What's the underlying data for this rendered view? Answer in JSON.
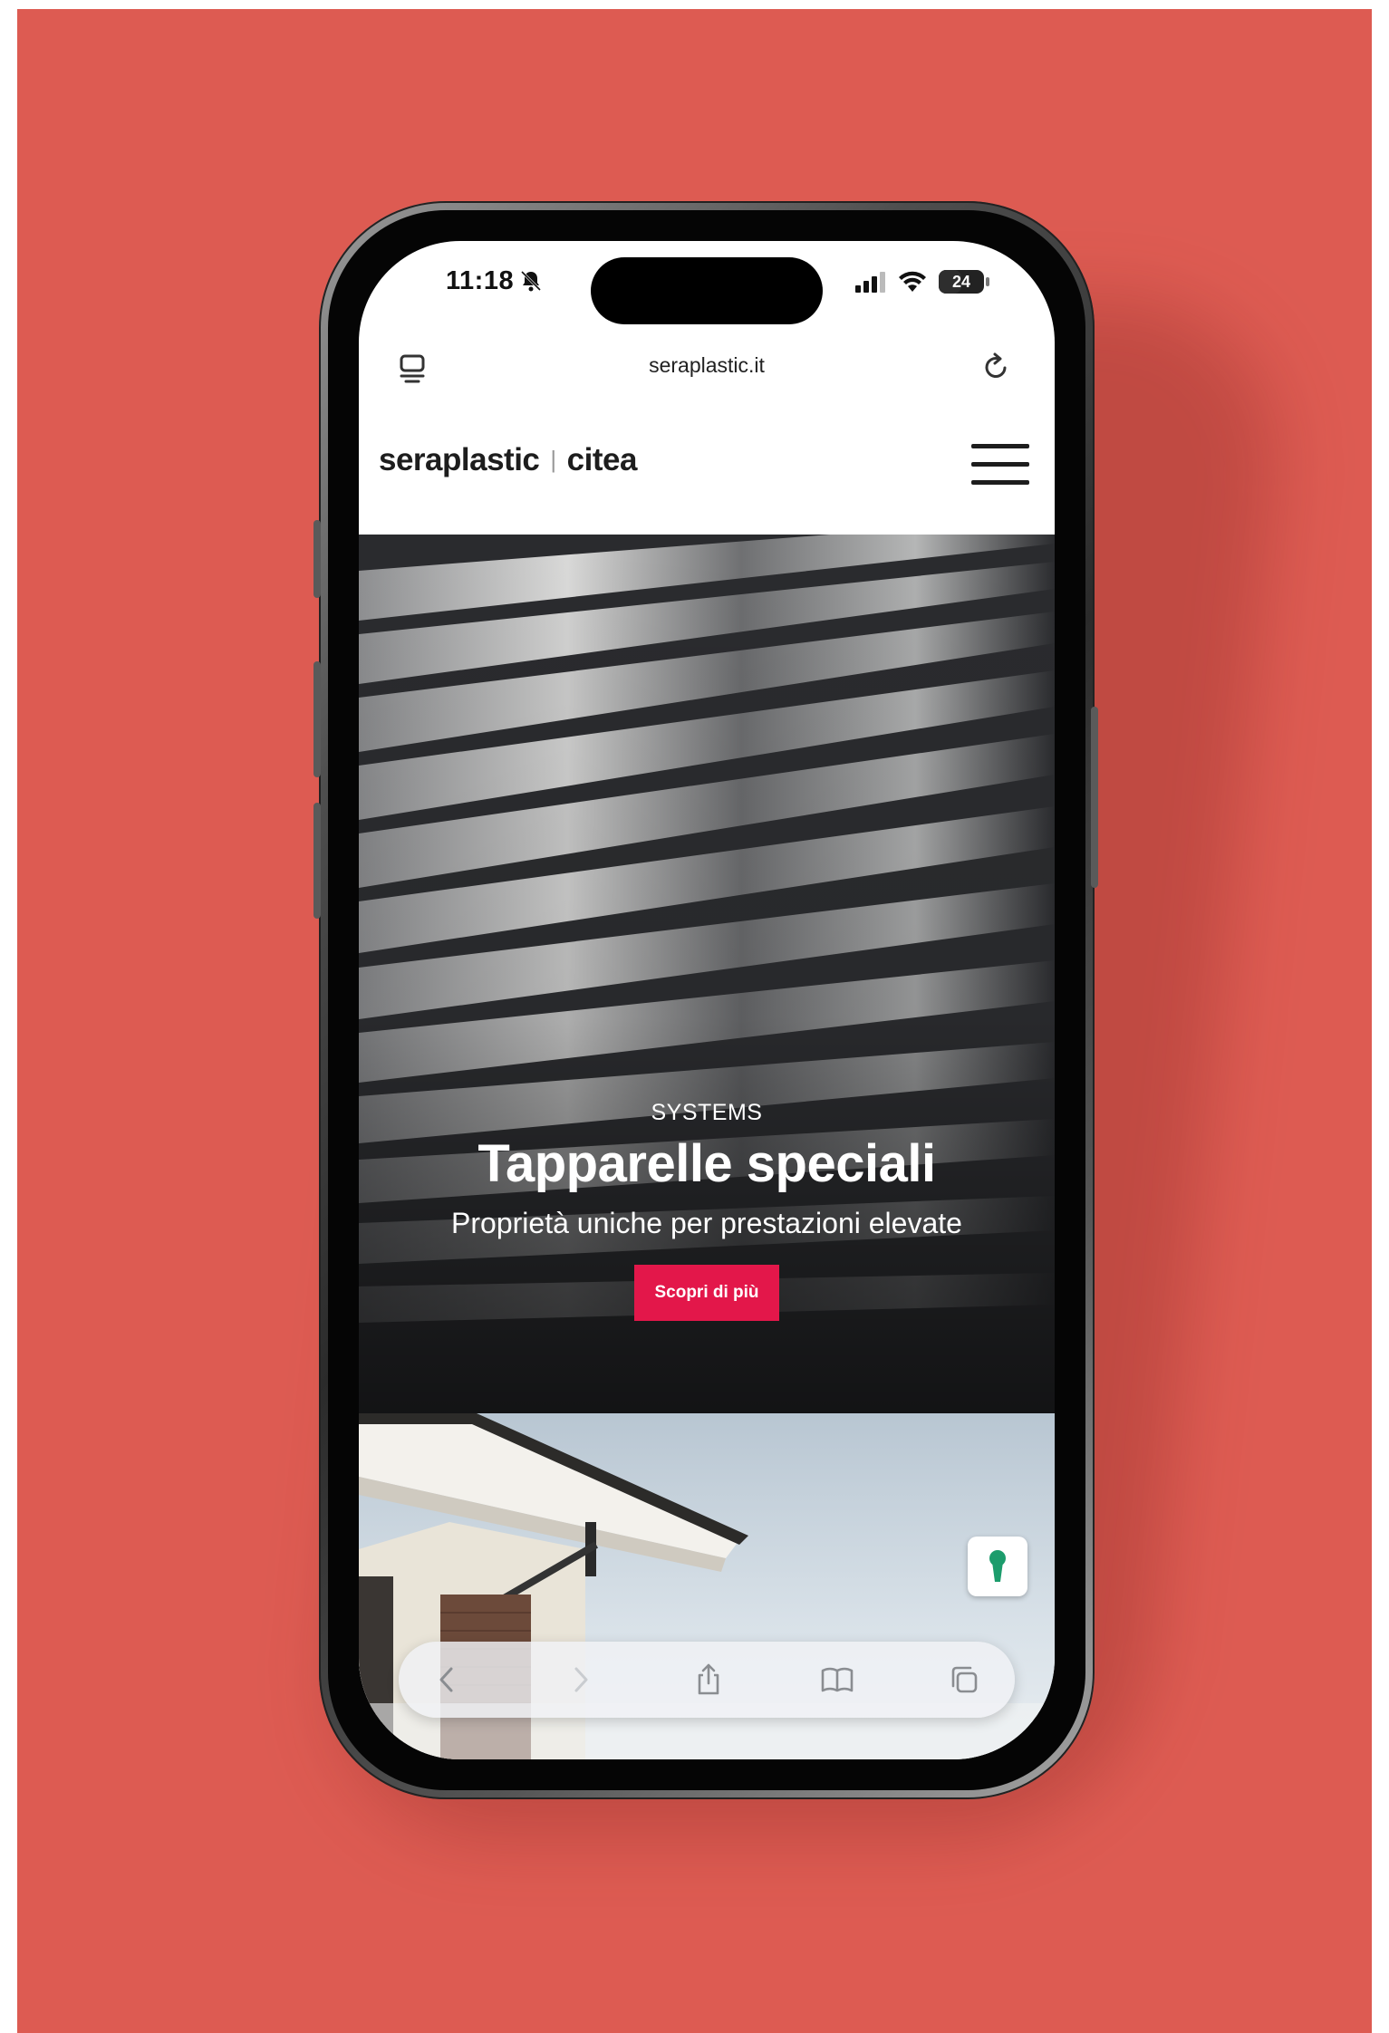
{
  "status_bar": {
    "time": "11:18",
    "battery": "24"
  },
  "browser": {
    "url": "seraplastic.it"
  },
  "site": {
    "logo_left": "seraplastic",
    "logo_separator": "|",
    "logo_right": "citea"
  },
  "hero": {
    "kicker": "SYSTEMS",
    "title": "Tapparelle speciali",
    "subtitle": "Proprietà uniche per prestazioni elevate",
    "cta_label": "Scopri di più"
  },
  "colors": {
    "background": "#dd5b52",
    "cta": "#e3174a",
    "float_button_icon": "#1c9c6c"
  },
  "icons": {
    "status": [
      "bell-slash-icon",
      "signal-icon",
      "wifi-icon",
      "battery-icon"
    ],
    "address_bar": [
      "tab-overview-icon",
      "reload-icon"
    ],
    "header": [
      "hamburger-menu-icon"
    ],
    "floating": [
      "keyhole-icon"
    ],
    "toolbar": [
      "back-icon",
      "forward-icon",
      "share-icon",
      "bookmarks-icon",
      "tabs-icon"
    ]
  }
}
